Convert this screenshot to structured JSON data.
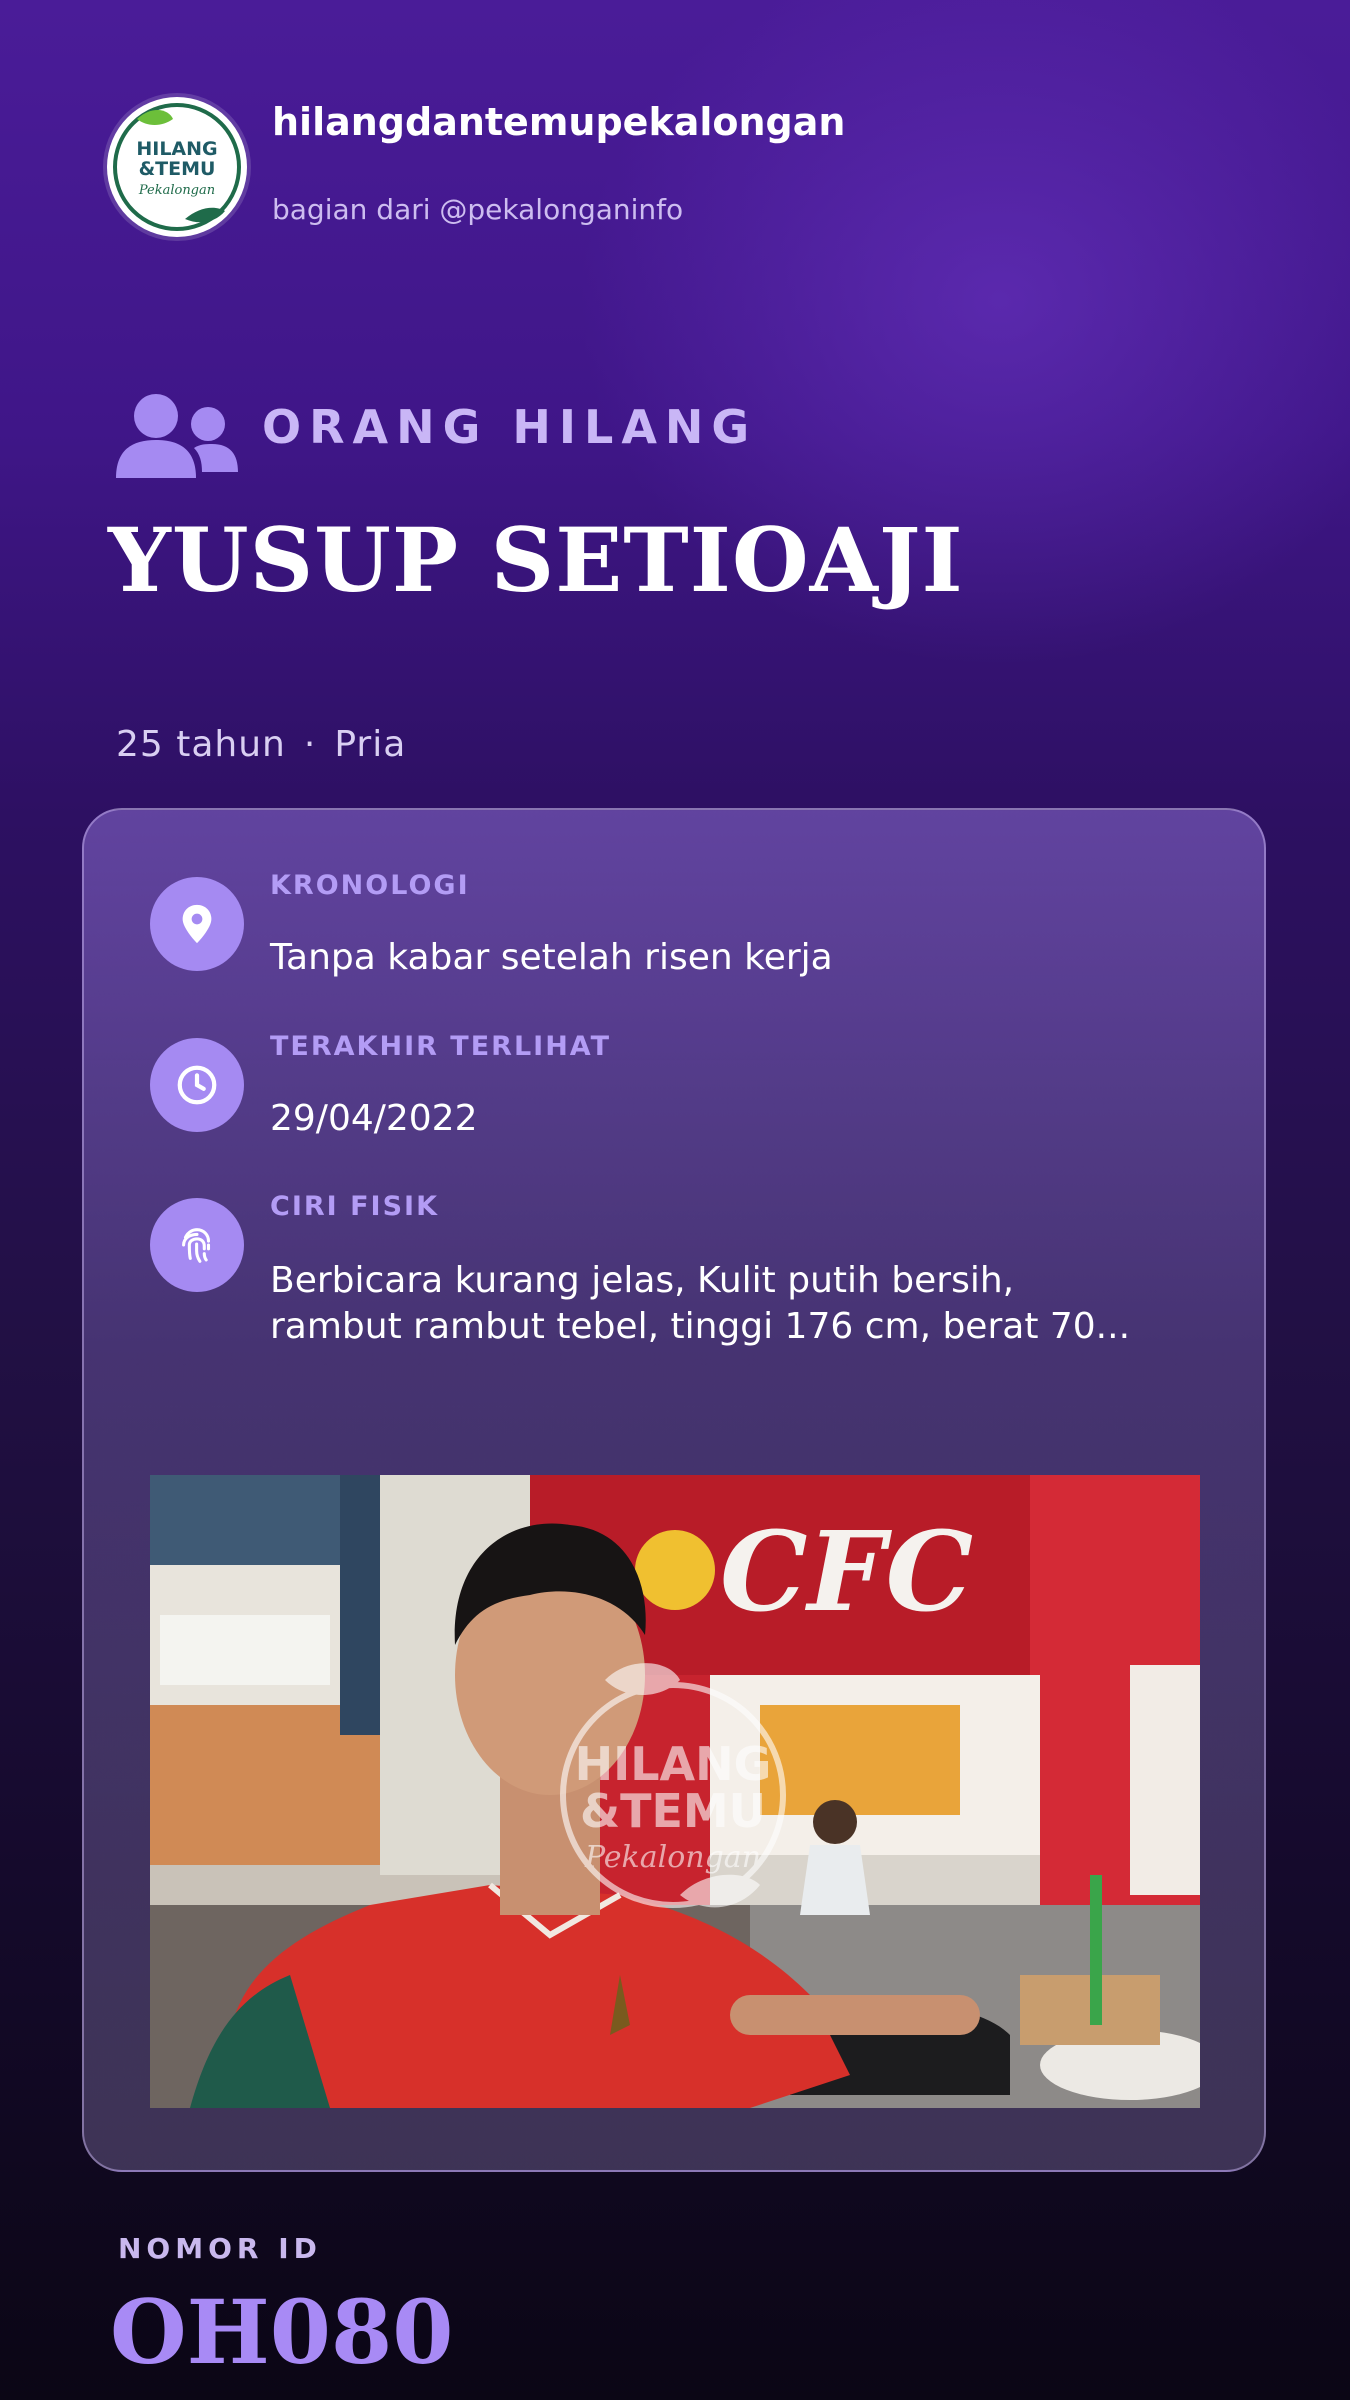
{
  "header": {
    "logo_text_lines": [
      "HILANG",
      "&TEMU",
      "Pekalongan"
    ],
    "handle": "hilangdantemupekalongan",
    "sub_handle": "bagian dari @pekalonganinfo"
  },
  "category": {
    "icon": "people-icon",
    "label": "ORANG HILANG"
  },
  "person": {
    "name": "YUSUP SETIOAJI",
    "age": "25 tahun",
    "separator": "·",
    "gender": "Pria"
  },
  "details": [
    {
      "icon": "location-pin-icon",
      "label": "KRONOLOGI",
      "value": "Tanpa kabar setelah risen kerja"
    },
    {
      "icon": "clock-icon",
      "label": "TERAKHIR TERLIHAT",
      "value": "29/04/2022"
    },
    {
      "icon": "fingerprint-icon",
      "label": "CIRI FISIK",
      "value_lines": [
        "Berbicara kurang jelas, Kulit putih bersih,",
        "rambut rambut tebel, tinggi 176 cm, berat 70..."
      ]
    }
  ],
  "photo": {
    "signage_text": "CFC",
    "watermark_lines": [
      "HILANG",
      "&TEMU",
      "Pekalongan"
    ]
  },
  "footer": {
    "id_label": "NOMOR ID",
    "id_value": "OH080"
  },
  "colors": {
    "accent": "#a58af2",
    "label": "#b39cf5",
    "bg_top": "#4a1c98",
    "bg_bottom": "#0b0615",
    "logo_green": "#1f6b4a"
  }
}
